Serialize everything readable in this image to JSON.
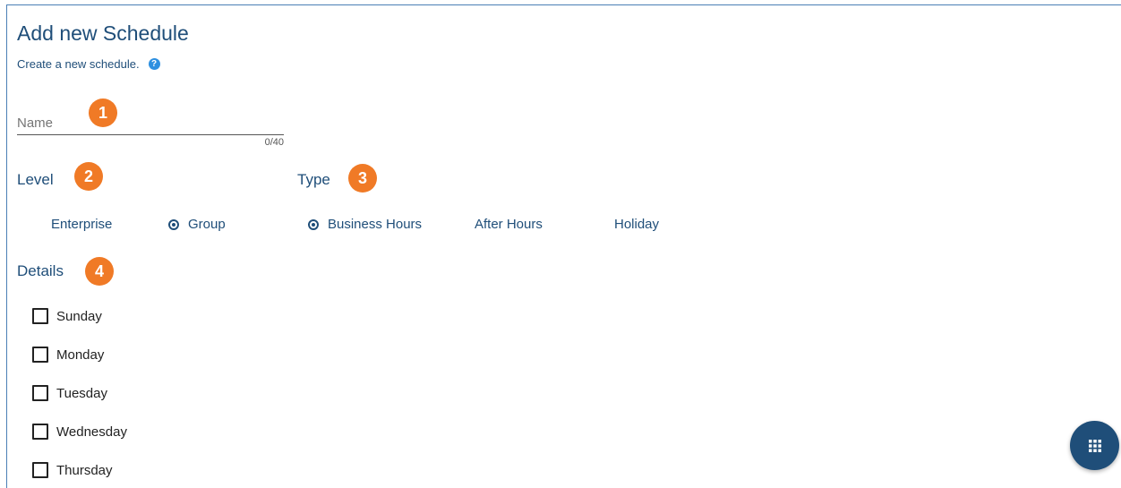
{
  "page": {
    "title": "Add new Schedule",
    "subtitle": "Create a new schedule."
  },
  "name_field": {
    "placeholder": "Name",
    "value": "",
    "counter": "0/40"
  },
  "badges": [
    "1",
    "2",
    "3",
    "4"
  ],
  "level": {
    "label": "Level",
    "options": [
      {
        "label": "Enterprise",
        "selected": false
      },
      {
        "label": "Group",
        "selected": true
      }
    ]
  },
  "type": {
    "label": "Type",
    "options": [
      {
        "label": "Business Hours",
        "selected": true
      },
      {
        "label": "After Hours",
        "selected": false
      },
      {
        "label": "Holiday",
        "selected": false
      }
    ]
  },
  "details": {
    "label": "Details",
    "days": [
      {
        "label": "Sunday",
        "checked": false
      },
      {
        "label": "Monday",
        "checked": false
      },
      {
        "label": "Tuesday",
        "checked": false
      },
      {
        "label": "Wednesday",
        "checked": false
      },
      {
        "label": "Thursday",
        "checked": false
      }
    ]
  },
  "icons": {
    "help": "help-icon",
    "fab": "grid-icon"
  },
  "colors": {
    "accent": "#1f4e79",
    "badge": "#f07a26",
    "help": "#2e90e0"
  }
}
